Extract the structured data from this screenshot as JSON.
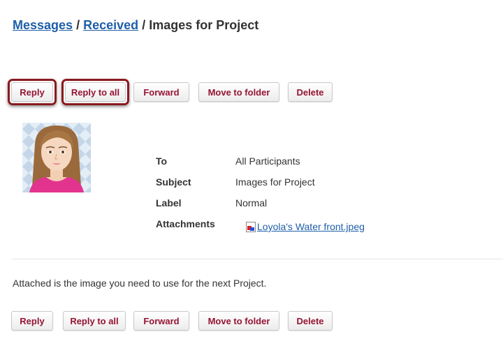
{
  "breadcrumb": {
    "messages": "Messages",
    "received": "Received",
    "separator": "/",
    "current": "Images for Project"
  },
  "buttons": {
    "reply": "Reply",
    "reply_all": "Reply to all",
    "forward": "Forward",
    "move": "Move to folder",
    "delete": "Delete"
  },
  "highlighted_buttons": [
    "Reply",
    "Reply to all"
  ],
  "colors": {
    "button_text": "#951433",
    "highlight_border": "#8a1a1f",
    "link": "#1f5fa8"
  },
  "message": {
    "to_label": "To",
    "to_value": "All Participants",
    "subject_label": "Subject",
    "subject_value": "Images for Project",
    "label_label": "Label",
    "label_value": "Normal",
    "attachments_label": "Attachments",
    "attachment_name": "Loyola's Water front.jpeg",
    "attachment_icon": "image-file-icon",
    "body": "Attached is the image you need to use for the next Project."
  }
}
